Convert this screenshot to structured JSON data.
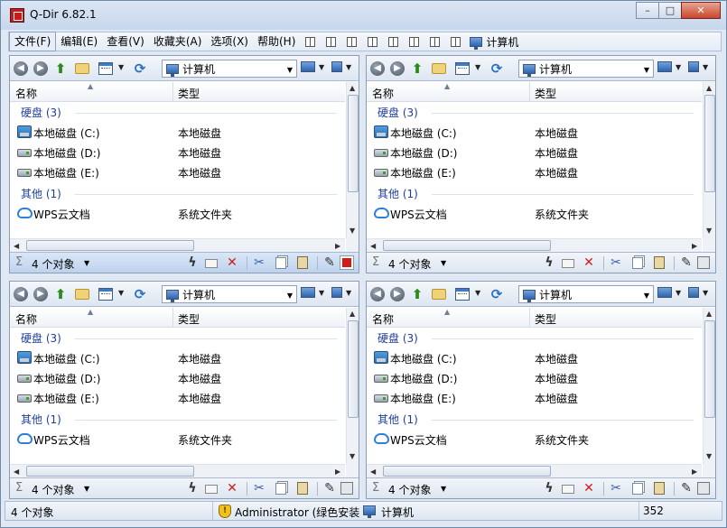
{
  "window": {
    "title": "Q-Dir 6.82.1",
    "buttons": {
      "minimize": "–",
      "maximize": "□",
      "close": "✕"
    }
  },
  "menu": {
    "items": [
      "文件(F)",
      "编辑(E)",
      "查看(V)",
      "收藏夹(A)",
      "选项(X)",
      "帮助(H)"
    ],
    "computer": "计算机"
  },
  "panes": [
    {
      "address": "计算机",
      "columns": {
        "name": "名称",
        "type": "类型"
      },
      "groups": [
        {
          "label": "硬盘 (3)",
          "items": [
            {
              "name": "本地磁盘 (C:)",
              "type": "本地磁盘",
              "icon": "system-drive-icon"
            },
            {
              "name": "本地磁盘 (D:)",
              "type": "本地磁盘",
              "icon": "drive-icon"
            },
            {
              "name": "本地磁盘 (E:)",
              "type": "本地磁盘",
              "icon": "drive-icon"
            }
          ]
        },
        {
          "label": "其他 (1)",
          "items": [
            {
              "name": "WPS云文档",
              "type": "系统文件夹",
              "icon": "cloud-icon"
            }
          ]
        }
      ],
      "status": "4 个对象",
      "active": true
    },
    {
      "address": "计算机",
      "columns": {
        "name": "名称",
        "type": "类型"
      },
      "groups": [
        {
          "label": "硬盘 (3)",
          "items": [
            {
              "name": "本地磁盘 (C:)",
              "type": "本地磁盘",
              "icon": "system-drive-icon"
            },
            {
              "name": "本地磁盘 (D:)",
              "type": "本地磁盘",
              "icon": "drive-icon"
            },
            {
              "name": "本地磁盘 (E:)",
              "type": "本地磁盘",
              "icon": "drive-icon"
            }
          ]
        },
        {
          "label": "其他 (1)",
          "items": [
            {
              "name": "WPS云文档",
              "type": "系统文件夹",
              "icon": "cloud-icon"
            }
          ]
        }
      ],
      "status": "4 个对象",
      "active": false
    },
    {
      "address": "计算机",
      "columns": {
        "name": "名称",
        "type": "类型"
      },
      "groups": [
        {
          "label": "硬盘 (3)",
          "items": [
            {
              "name": "本地磁盘 (C:)",
              "type": "本地磁盘",
              "icon": "system-drive-icon"
            },
            {
              "name": "本地磁盘 (D:)",
              "type": "本地磁盘",
              "icon": "drive-icon"
            },
            {
              "name": "本地磁盘 (E:)",
              "type": "本地磁盘",
              "icon": "drive-icon"
            }
          ]
        },
        {
          "label": "其他 (1)",
          "items": [
            {
              "name": "WPS云文档",
              "type": "系统文件夹",
              "icon": "cloud-icon"
            }
          ]
        }
      ],
      "status": "4 个对象",
      "active": false
    },
    {
      "address": "计算机",
      "columns": {
        "name": "名称",
        "type": "类型"
      },
      "groups": [
        {
          "label": "硬盘 (3)",
          "items": [
            {
              "name": "本地磁盘 (C:)",
              "type": "本地磁盘",
              "icon": "system-drive-icon"
            },
            {
              "name": "本地磁盘 (D:)",
              "type": "本地磁盘",
              "icon": "drive-icon"
            },
            {
              "name": "本地磁盘 (E:)",
              "type": "本地磁盘",
              "icon": "drive-icon"
            }
          ]
        },
        {
          "label": "其他 (1)",
          "items": [
            {
              "name": "WPS云文档",
              "type": "系统文件夹",
              "icon": "cloud-icon"
            }
          ]
        }
      ],
      "status": "4 个对象",
      "active": false
    }
  ],
  "statusbar": {
    "objects": "4 个对象",
    "user": "Administrator (绿色安装",
    "location": "计算机",
    "number": "352"
  },
  "colors": {
    "accent": "#1e3d9a",
    "active_status": "#bfd3ee",
    "close": "#c9462c"
  }
}
